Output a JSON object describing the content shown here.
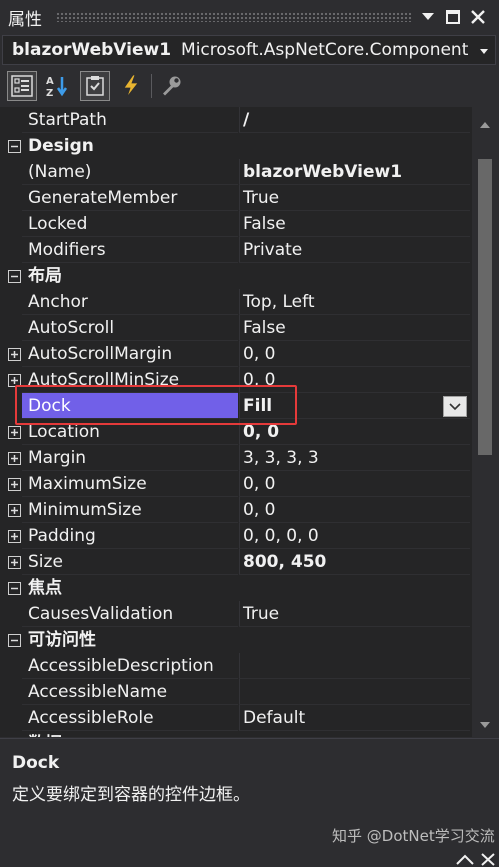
{
  "window": {
    "title": "属性",
    "icons": [
      "dropdown-arrow-icon",
      "maximize-icon",
      "close-icon"
    ]
  },
  "object_selector": {
    "name": "blazorWebView1",
    "type": "Microsoft.AspNetCore.Component"
  },
  "toolbar": {
    "buttons": [
      "categorized-icon",
      "alphabetical-icon",
      "properties-icon",
      "events-icon",
      "property-pages-icon"
    ]
  },
  "grid": {
    "rows": [
      {
        "kind": "prop",
        "name": "StartPath",
        "value": "/",
        "bold": true
      },
      {
        "kind": "cat",
        "label": "Design"
      },
      {
        "kind": "prop",
        "name": "(Name)",
        "value": "blazorWebView1",
        "bold": true
      },
      {
        "kind": "prop",
        "name": "GenerateMember",
        "value": "True"
      },
      {
        "kind": "prop",
        "name": "Locked",
        "value": "False"
      },
      {
        "kind": "prop",
        "name": "Modifiers",
        "value": "Private"
      },
      {
        "kind": "cat",
        "label": "布局"
      },
      {
        "kind": "prop",
        "name": "Anchor",
        "value": "Top, Left"
      },
      {
        "kind": "prop",
        "name": "AutoScroll",
        "value": "False"
      },
      {
        "kind": "prop",
        "name": "AutoScrollMargin",
        "value": "0, 0",
        "expandable": true
      },
      {
        "kind": "prop",
        "name": "AutoScrollMinSize",
        "value": "0, 0",
        "expandable": true
      },
      {
        "kind": "prop",
        "name": "Dock",
        "value": "Fill",
        "bold": true,
        "selected": true
      },
      {
        "kind": "prop",
        "name": "Location",
        "value": "0, 0",
        "bold": true,
        "expandable": true
      },
      {
        "kind": "prop",
        "name": "Margin",
        "value": "3, 3, 3, 3",
        "expandable": true
      },
      {
        "kind": "prop",
        "name": "MaximumSize",
        "value": "0, 0",
        "expandable": true
      },
      {
        "kind": "prop",
        "name": "MinimumSize",
        "value": "0, 0",
        "expandable": true
      },
      {
        "kind": "prop",
        "name": "Padding",
        "value": "0, 0, 0, 0",
        "expandable": true
      },
      {
        "kind": "prop",
        "name": "Size",
        "value": "800, 450",
        "bold": true,
        "expandable": true
      },
      {
        "kind": "cat",
        "label": "焦点"
      },
      {
        "kind": "prop",
        "name": "CausesValidation",
        "value": "True"
      },
      {
        "kind": "cat",
        "label": "可访问性"
      },
      {
        "kind": "prop",
        "name": "AccessibleDescription",
        "value": ""
      },
      {
        "kind": "prop",
        "name": "AccessibleName",
        "value": ""
      },
      {
        "kind": "prop",
        "name": "AccessibleRole",
        "value": "Default"
      },
      {
        "kind": "cat",
        "label": "数据"
      }
    ]
  },
  "description": {
    "title": "Dock",
    "text": "定义要绑定到容器的控件边框。"
  },
  "watermark": "知乎 @DotNet学习交流"
}
